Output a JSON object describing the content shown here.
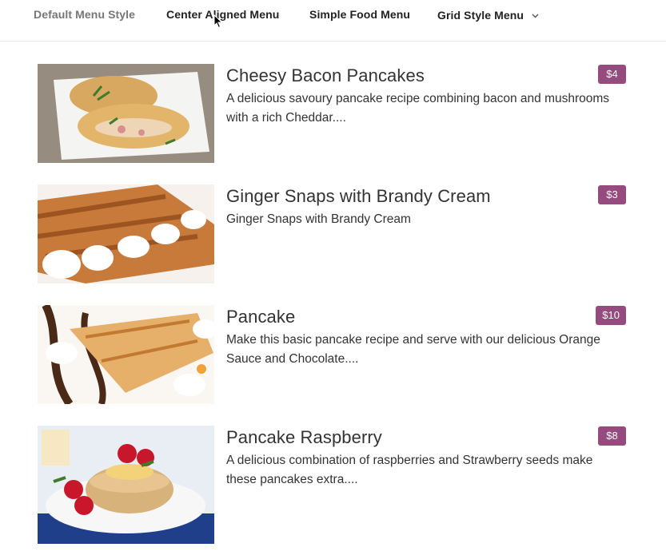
{
  "nav": {
    "items": [
      {
        "label": "Default Menu Style"
      },
      {
        "label": "Center Aligned Menu"
      },
      {
        "label": "Simple Food Menu"
      },
      {
        "label": "Grid Style Menu"
      }
    ]
  },
  "menu": {
    "items": [
      {
        "title": "Cheesy Bacon Pancakes",
        "description": "A delicious savoury pancake recipe combining bacon and mushrooms with a rich Cheddar....",
        "price": "$4"
      },
      {
        "title": "Ginger Snaps with Brandy Cream",
        "description": "Ginger Snaps with Brandy Cream",
        "price": "$3"
      },
      {
        "title": "Pancake",
        "description": "Make this basic pancake recipe and serve with our delicious Orange Sauce and Chocolate....",
        "price": "$10"
      },
      {
        "title": "Pancake Raspberry",
        "description": "A delicious combination of raspberries and Strawberry seeds make these pancakes extra....",
        "price": "$8"
      }
    ]
  },
  "colors": {
    "price_badge": "#954b7e",
    "nav_muted": "#767676",
    "text": "#333333"
  },
  "icons": [
    "chevron-down-icon",
    "mouse-cursor-icon"
  ]
}
